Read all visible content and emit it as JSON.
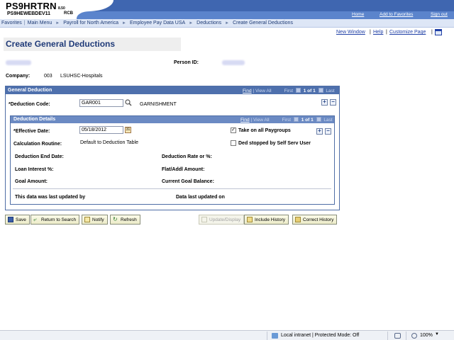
{
  "header": {
    "system_name": "PS9HRTRN",
    "version": "8.50",
    "database": "PS9HEWEBDEV11",
    "user_code": "RCB",
    "links": [
      "Home",
      "Add to Favorites",
      "Sign out"
    ]
  },
  "breadcrumbs": {
    "items": [
      "Favorites",
      "Main Menu",
      "Payroll for North America",
      "Employee Pay Data USA",
      "Deductions",
      "Create General Deductions"
    ]
  },
  "page_links": {
    "new_window": "New Window",
    "help": "Help",
    "customize_page": "Customize Page"
  },
  "page": {
    "title": "Create General Deductions",
    "person_id_label": "Person ID:",
    "company_label": "Company:",
    "company_code": "003",
    "company_name": "LSUHSC-Hospitals"
  },
  "general_deduction": {
    "header": "General Deduction",
    "nav": {
      "find": "Find",
      "view_all": "View All",
      "first": "First",
      "position": "1 of 1",
      "last": "Last"
    },
    "deduction_code_label": "*Deduction Code:",
    "deduction_code_value": "GAR001",
    "deduction_code_desc": "GARNISHMENT"
  },
  "deduction_details": {
    "header": "Deduction Details",
    "nav": {
      "find": "Find",
      "view_all": "View All",
      "first": "First",
      "position": "1 of 1",
      "last": "Last"
    },
    "effective_date_label": "*Effective Date:",
    "effective_date_value": "05/18/2012",
    "take_on_all_paygroups": "Take on all Paygroups",
    "take_on_all_paygroups_checked": true,
    "ded_stopped_label": "Ded stopped by Self Serv User",
    "ded_stopped_checked": false,
    "calc_routine_label": "Calculation Routine:",
    "calc_routine_value": "Default to Deduction Table",
    "deduction_end_date_label": "Deduction End Date:",
    "deduction_rate_label": "Deduction Rate or %:",
    "loan_interest_label": "Loan Interest %:",
    "flat_addl_amount_label": "Flat/Addl Amount:",
    "goal_amount_label": "Goal Amount:",
    "current_goal_balance_label": "Current Goal Balance:",
    "last_updated_by_label": "This data was last updated by",
    "data_last_updated_on_label": "Data last updated on"
  },
  "toolbar": {
    "save": "Save",
    "return_to_search": "Return to Search",
    "notify": "Notify",
    "refresh": "Refresh",
    "update_display": "Update/Display",
    "include_history": "Include History",
    "correct_history": "Correct History"
  },
  "statusbar": {
    "zone": "Local intranet | Protected Mode: Off",
    "zoom": "100%"
  },
  "colors": {
    "header_dark": "#3f66b0",
    "header_light": "#5b84cc",
    "group_header": "#4e70ad",
    "title_text": "#1f3a78",
    "link": "#1f3fa6"
  }
}
